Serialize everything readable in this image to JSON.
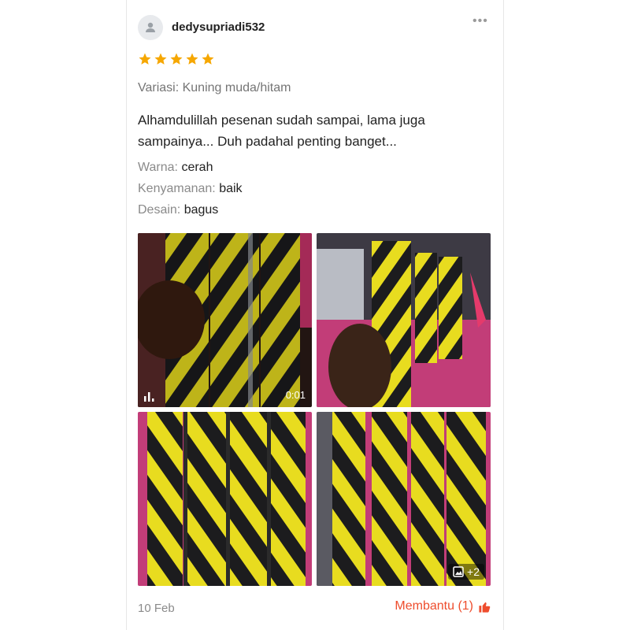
{
  "review": {
    "username": "dedysupriadi532",
    "rating": 5,
    "variation": "Variasi: Kuning muda/hitam",
    "comment": "Alhamdulillah pesenan sudah sampai, lama juga sampainya... Duh padahal penting banget...",
    "attributes": [
      {
        "key": "Warna:",
        "value": "cerah"
      },
      {
        "key": "Kenyamanan:",
        "value": "baik"
      },
      {
        "key": "Desain:",
        "value": "bagus"
      }
    ],
    "media": {
      "video_duration": "0:01",
      "more_count": "+2"
    },
    "date": "10 Feb",
    "helpful_label": "Membantu (1)"
  },
  "colors": {
    "accent": "#ee4d2d",
    "star": "#f6a700",
    "stripe_yellow": "#e8dc1f",
    "stripe_black": "#1c1c1e"
  },
  "icons": [
    "user-icon",
    "more-icon",
    "star-icon",
    "video-bars-icon",
    "image-icon",
    "thumbs-up-icon"
  ]
}
